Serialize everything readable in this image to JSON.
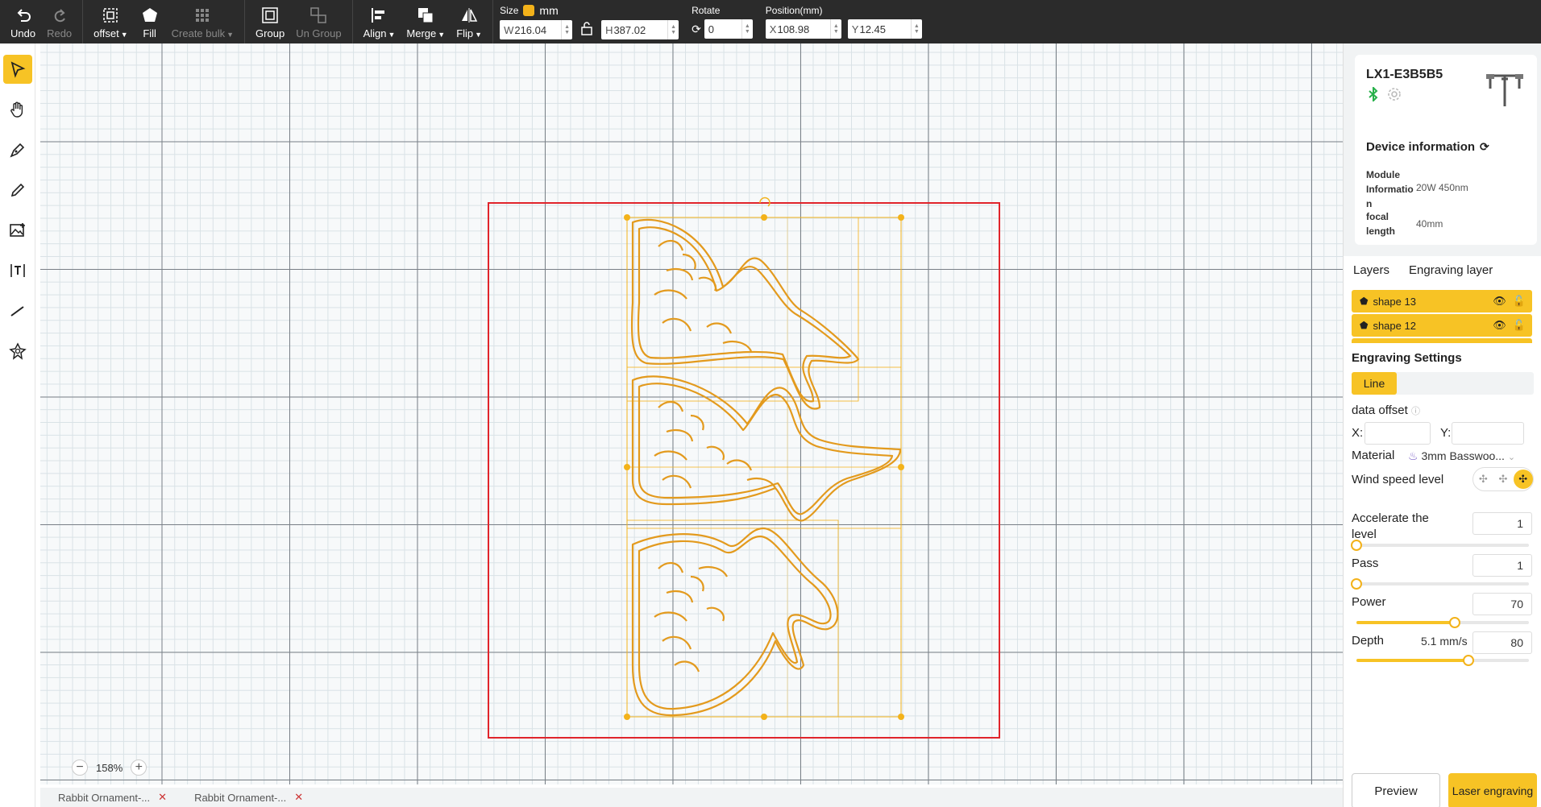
{
  "toolbar": {
    "undo": "Undo",
    "redo": "Redo",
    "offset": "offset",
    "fill": "Fill",
    "create_bulk": "Create bulk",
    "group": "Group",
    "ungroup": "Un Group",
    "align": "Align",
    "merge": "Merge",
    "flip": "Flip",
    "size_label": "Size",
    "unit": "mm",
    "width_prefix": "W",
    "width_value": "216.04",
    "height_prefix": "H",
    "height_value": "387.02",
    "rotate_label": "Rotate",
    "rotate_value": "0",
    "position_label": "Position(mm)",
    "x_prefix": "X",
    "x_value": "108.98",
    "y_prefix": "Y",
    "y_value": "12.45"
  },
  "left_tools": [
    "select-icon",
    "hand-icon",
    "pen-icon",
    "pencil-icon",
    "image-icon",
    "text-icon",
    "line-icon",
    "shape-icon"
  ],
  "canvas": {
    "zoom": "158%",
    "workarea_color": "#e0242b",
    "selection_color": "#f3b21a"
  },
  "doc_tabs": [
    {
      "label": "Rabbit Ornament-..."
    },
    {
      "label": "Rabbit Ornament-..."
    }
  ],
  "device": {
    "name": "LX1-E3B5B5",
    "info_title": "Device information",
    "module_key": "Module Informatio n",
    "module_value": "20W 450nm",
    "focal_key": "focal length",
    "focal_value": "40mm"
  },
  "layers": {
    "tabs": [
      "Layers",
      "Engraving layer"
    ],
    "items": [
      {
        "name": "shape 13"
      },
      {
        "name": "shape 12"
      }
    ]
  },
  "engraving": {
    "title": "Engraving Settings",
    "mode": "Line",
    "data_offset_label": "data offset",
    "x_label": "X:",
    "y_label": "Y:",
    "x_value": "",
    "y_value": "",
    "material_label": "Material",
    "material_value": "3mm Basswoo...",
    "wind_label": "Wind speed level",
    "accel_label": "Accelerate the level",
    "accel_value": "1",
    "pass_label": "Pass",
    "pass_value": "1",
    "power_label": "Power",
    "power_value": "70",
    "power_level": 0.57,
    "depth_label": "Depth",
    "depth_speed": "5.1 mm/s",
    "depth_value": "80",
    "depth_level": 0.65,
    "preview_button": "Preview",
    "laser_button": "Laser engraving"
  },
  "colors": {
    "accent": "#f7c325",
    "toolbar_bg": "#2b2b2b"
  }
}
